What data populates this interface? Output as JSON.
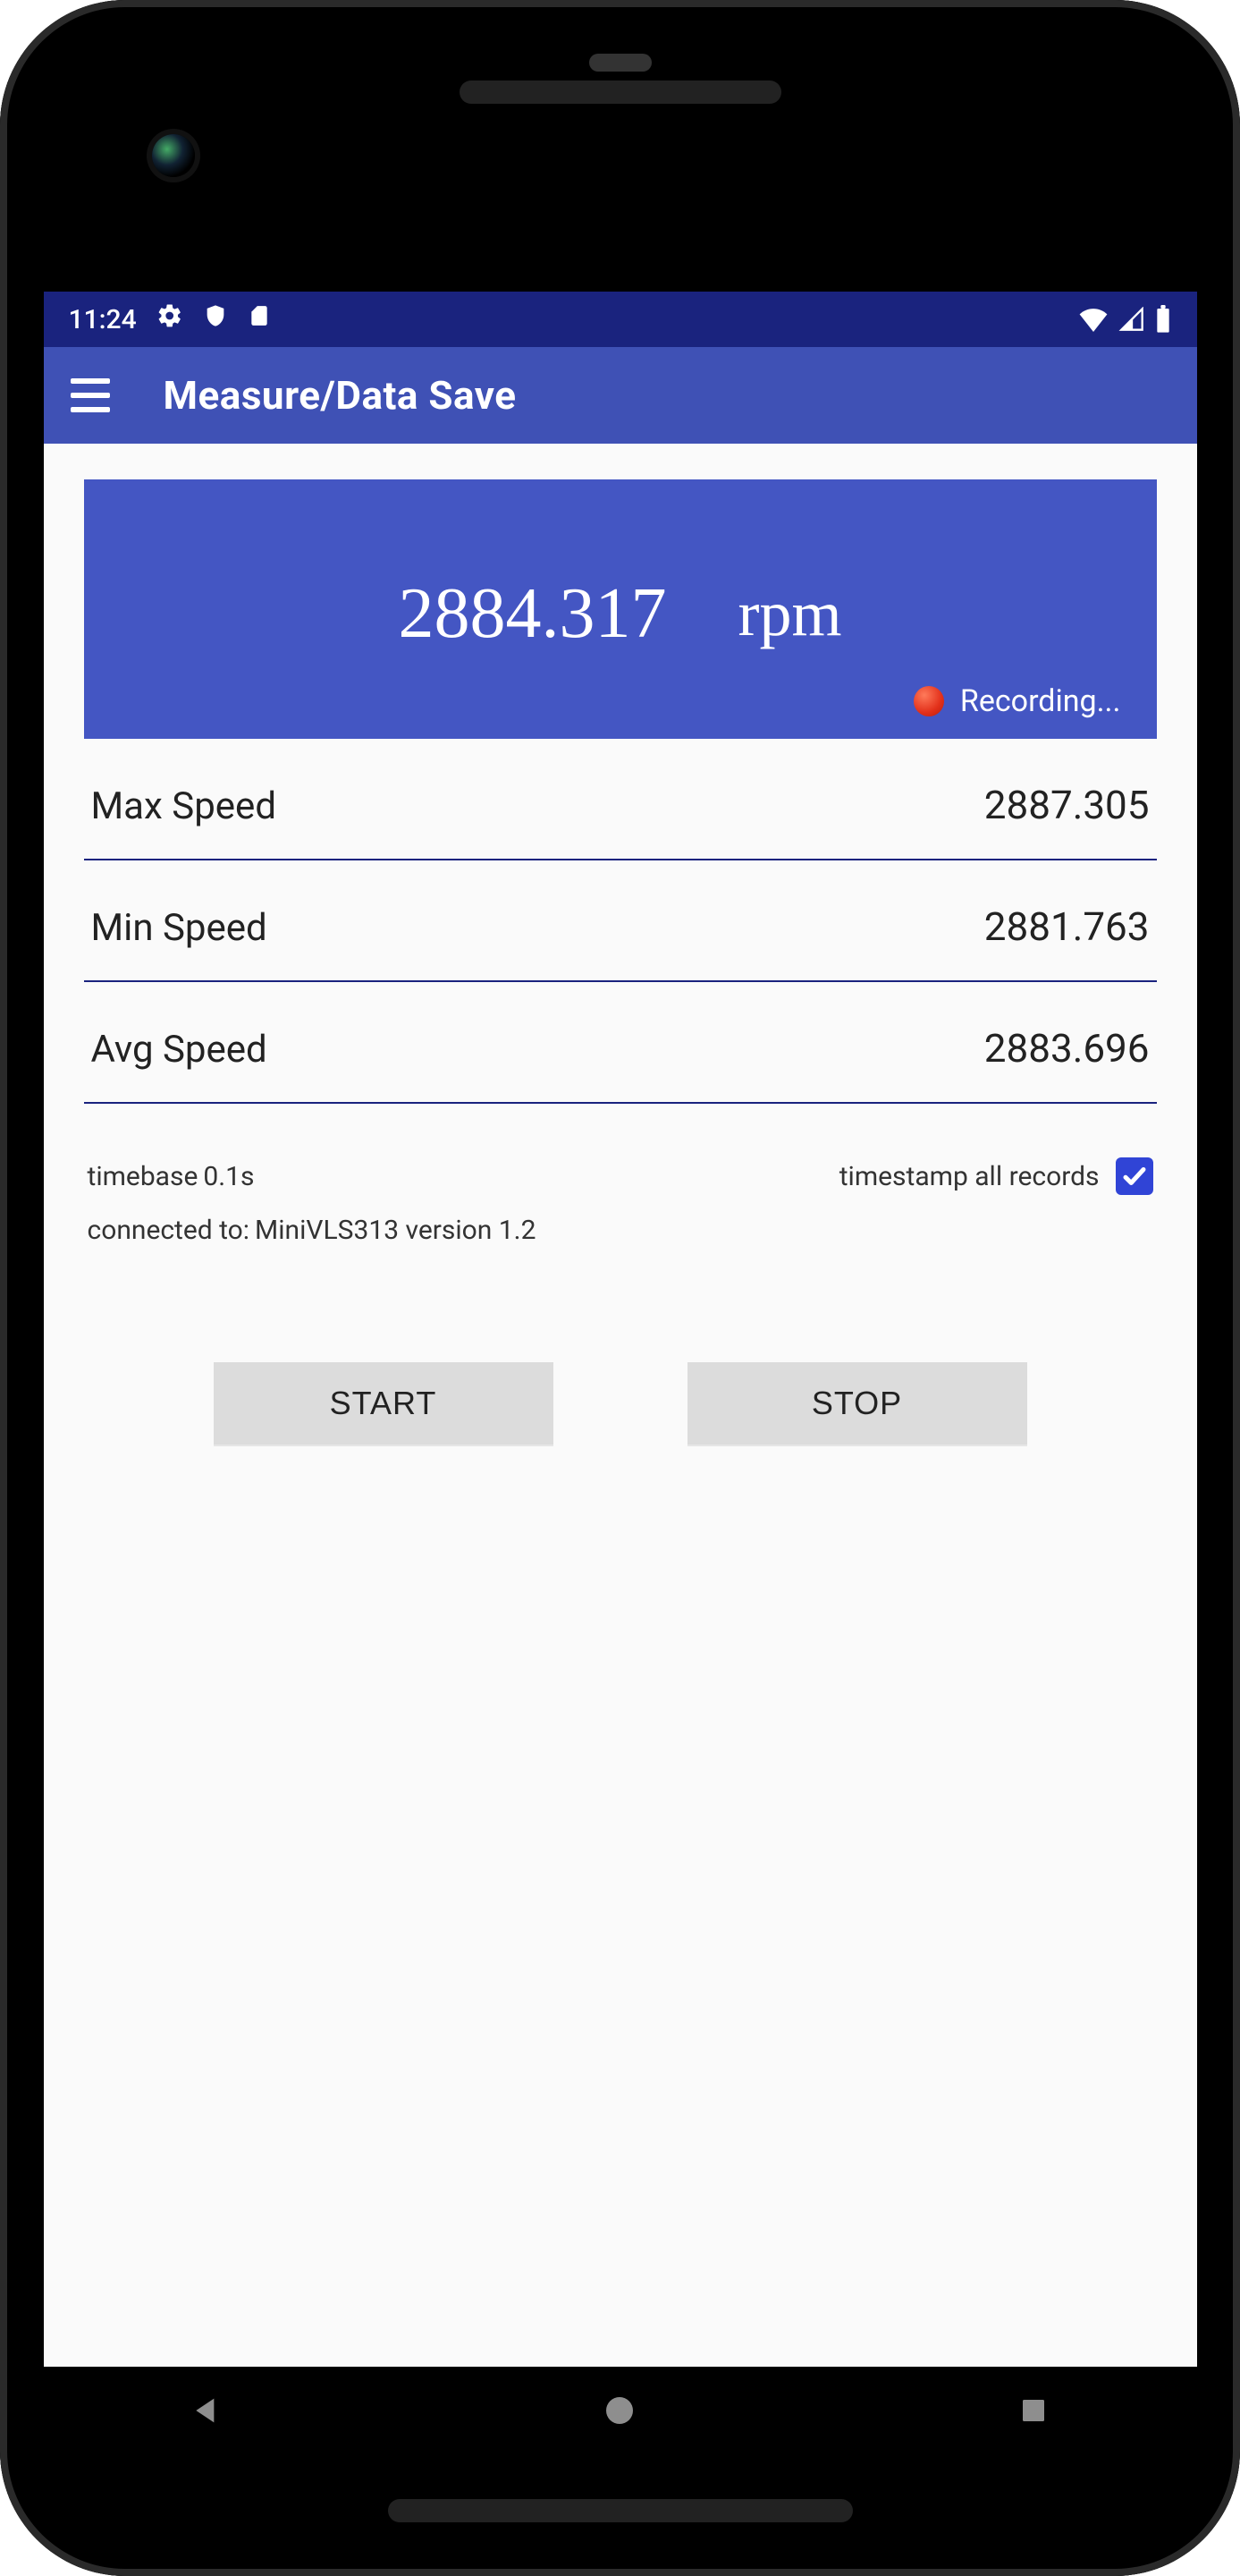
{
  "statusBar": {
    "time": "11:24"
  },
  "appBar": {
    "title": "Measure/Data Save"
  },
  "reading": {
    "value": "2884.317",
    "unit": "rpm",
    "recordingLabel": "Recording..."
  },
  "stats": {
    "max": {
      "label": "Max Speed",
      "value": "2887.305"
    },
    "min": {
      "label": "Min Speed",
      "value": "2881.763"
    },
    "avg": {
      "label": "Avg Speed",
      "value": "2883.696"
    }
  },
  "settings": {
    "timebaseLabel": "timebase",
    "timebaseValue": "0.1s",
    "timestampLabel": "timestamp all records",
    "timestampChecked": true,
    "connectedLabel": "connected to:",
    "connectedValue": "MiniVLS313 version 1.2"
  },
  "buttons": {
    "start": "START",
    "stop": "STOP"
  }
}
